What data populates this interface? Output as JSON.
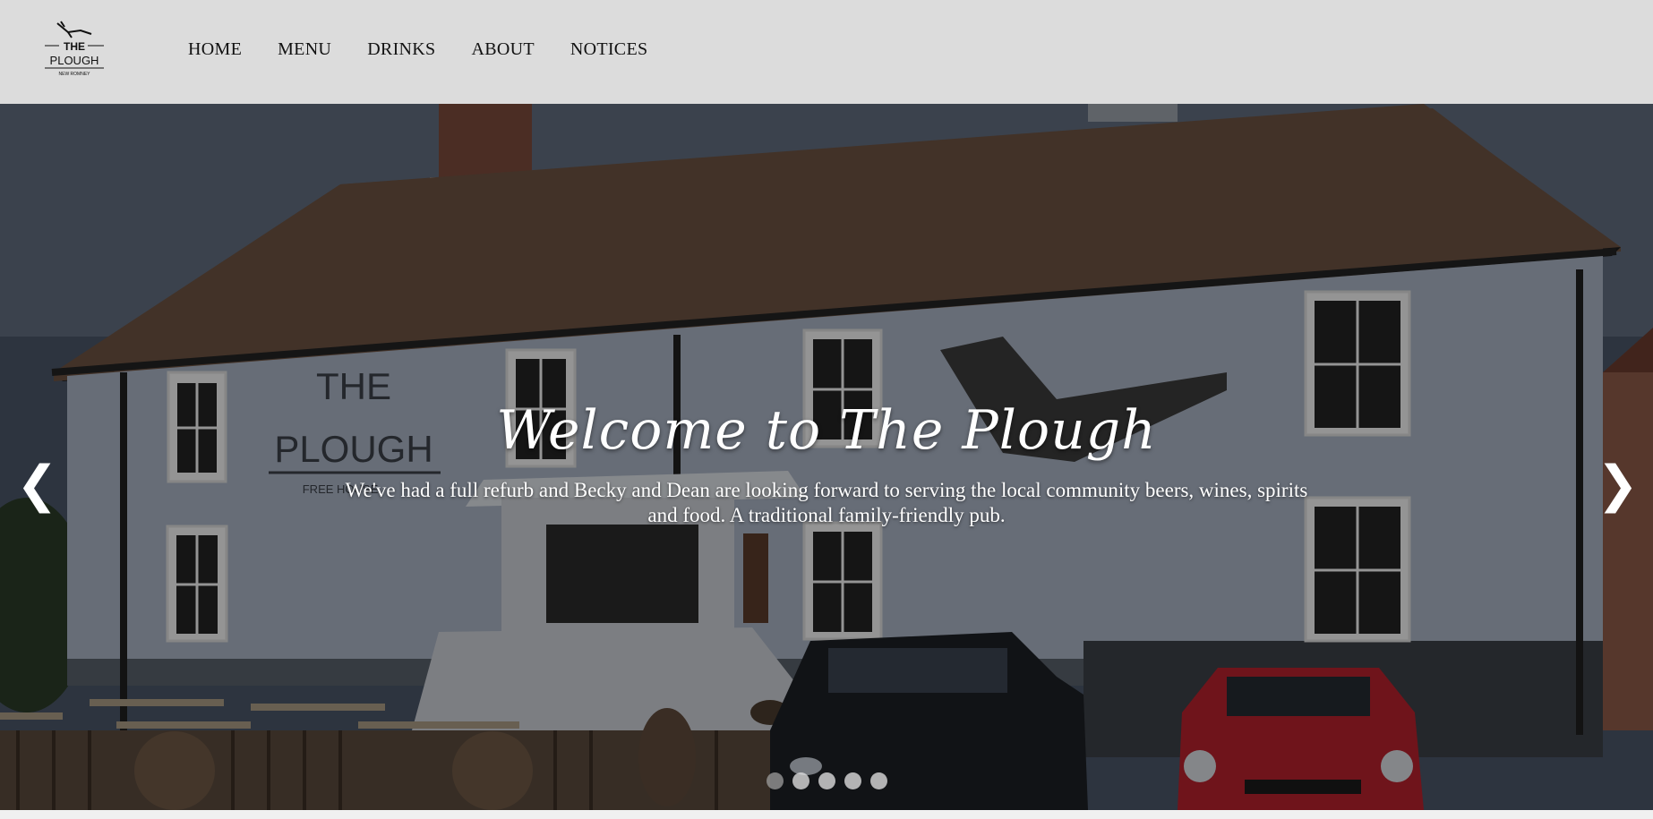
{
  "logo": {
    "line1": "THE",
    "line2": "PLOUGH",
    "line3": "NEW ROMNEY"
  },
  "nav": {
    "items": [
      {
        "label": "HOME"
      },
      {
        "label": "MENU"
      },
      {
        "label": "DRINKS"
      },
      {
        "label": "ABOUT"
      },
      {
        "label": "NOTICES"
      }
    ]
  },
  "hero": {
    "title": "Welcome to The Plough",
    "description": "We've had a full refurb and Becky and Dean are looking forward to serving the local community beers, wines, spirits and food. A traditional family-friendly pub.",
    "prev_glyph": "❮",
    "next_glyph": "❯",
    "slide_count": 5,
    "active_slide": 1,
    "sign_the": "THE",
    "sign_plough": "PLOUGH",
    "sign_freehouse": "FREE HOUSE"
  },
  "colors": {
    "header_bg": "#dcdcdc",
    "sky": "#3a414d",
    "wall": "#7d8591",
    "roof": "#4e3a2e",
    "car_red": "#b3212c",
    "car_black": "#1c1f24"
  }
}
